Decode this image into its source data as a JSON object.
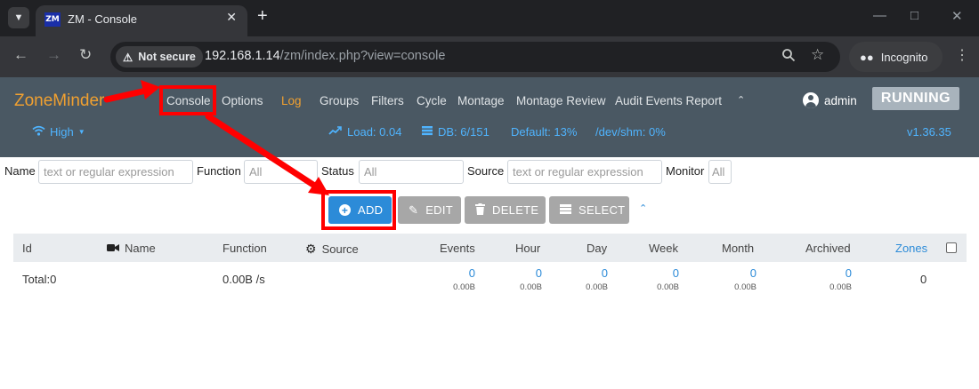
{
  "browser": {
    "tab_title": "ZM - Console",
    "favicon_text": "ZM",
    "security_label": "Not secure",
    "url_host": "192.168.1.14",
    "url_path": "/zm/index.php?view=console",
    "incognito_label": "Incognito"
  },
  "zm_nav": {
    "brand": "ZoneMinder",
    "links": [
      "Console",
      "Options",
      "Log",
      "Groups",
      "Filters",
      "Cycle",
      "Montage",
      "Montage Review",
      "Audit Events Report"
    ],
    "user": "admin",
    "state": "RUNNING",
    "bandwidth": "High",
    "load": "Load: 0.04",
    "db": "DB: 6/151",
    "default_storage": "Default: 13%",
    "shm": "/dev/shm: 0%",
    "version": "v1.36.35"
  },
  "filters": {
    "name_label": "Name",
    "name_placeholder": "text or regular expression",
    "function_label": "Function",
    "function_placeholder": "All",
    "status_label": "Status",
    "status_placeholder": "All",
    "source_label": "Source",
    "source_placeholder": "text or regular expression",
    "monitor_label": "Monitor",
    "monitor_placeholder": "All"
  },
  "actions": {
    "add": "ADD",
    "edit": "EDIT",
    "delete": "DELETE",
    "select": "SELECT"
  },
  "table": {
    "headers": {
      "id": "Id",
      "name": "Name",
      "function": "Function",
      "source": "Source",
      "events": "Events",
      "hour": "Hour",
      "day": "Day",
      "week": "Week",
      "month": "Month",
      "archived": "Archived",
      "zones": "Zones"
    },
    "total_row": {
      "label": "Total:0",
      "function": "0.00B /s",
      "events": "0",
      "events_size": "0.00B",
      "hour": "0",
      "hour_size": "0.00B",
      "day": "0",
      "day_size": "0.00B",
      "week": "0",
      "week_size": "0.00B",
      "month": "0",
      "month_size": "0.00B",
      "archived": "0",
      "archived_size": "0.00B",
      "zones": "0"
    }
  },
  "colors": {
    "accent": "#2c8bd8",
    "brand": "#f0a030",
    "annotation": "#ff0000"
  }
}
